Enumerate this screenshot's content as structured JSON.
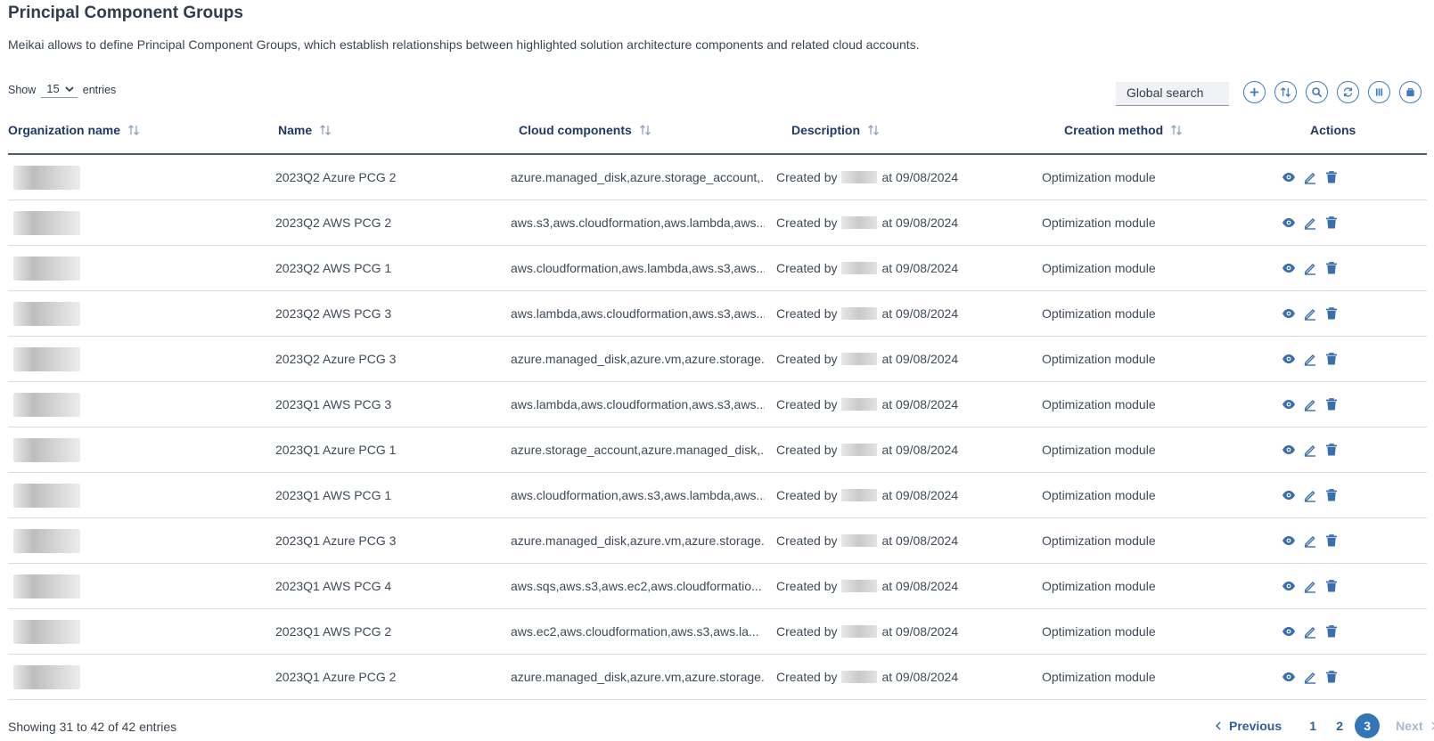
{
  "page": {
    "title": "Principal Component Groups",
    "description": "Meikai allows to define Principal Component Groups, which establish relationships between highlighted solution architecture components and related cloud accounts."
  },
  "length": {
    "show": "Show",
    "value": "15",
    "entries": "entries"
  },
  "search": {
    "placeholder": "Global search"
  },
  "toolbar": [
    "add-icon",
    "sort-icon",
    "search-icon",
    "refresh-icon",
    "columns-icon",
    "export-icon"
  ],
  "columns": {
    "org": "Organization name",
    "name": "Name",
    "cloud": "Cloud components",
    "desc": "Description",
    "method": "Creation method",
    "actions": "Actions"
  },
  "rows": [
    {
      "name": "2023Q2 Azure PCG 2",
      "cloud": "azure.managed_disk,azure.storage_account,...",
      "desc_prefix": "Created by",
      "desc_suffix": "at 09/08/2024",
      "method": "Optimization module"
    },
    {
      "name": "2023Q2 AWS PCG 2",
      "cloud": "aws.s3,aws.cloudformation,aws.lambda,aws...",
      "desc_prefix": "Created by",
      "desc_suffix": "at 09/08/2024",
      "method": "Optimization module"
    },
    {
      "name": "2023Q2 AWS PCG 1",
      "cloud": "aws.cloudformation,aws.lambda,aws.s3,aws...",
      "desc_prefix": "Created by",
      "desc_suffix": "at 09/08/2024",
      "method": "Optimization module"
    },
    {
      "name": "2023Q2 AWS PCG 3",
      "cloud": "aws.lambda,aws.cloudformation,aws.s3,aws...",
      "desc_prefix": "Created by",
      "desc_suffix": "at 09/08/2024",
      "method": "Optimization module"
    },
    {
      "name": "2023Q2 Azure PCG 3",
      "cloud": "azure.managed_disk,azure.vm,azure.storage...",
      "desc_prefix": "Created by",
      "desc_suffix": "at 09/08/2024",
      "method": "Optimization module"
    },
    {
      "name": "2023Q1 AWS PCG 3",
      "cloud": "aws.lambda,aws.cloudformation,aws.s3,aws...",
      "desc_prefix": "Created by",
      "desc_suffix": "at 09/08/2024",
      "method": "Optimization module"
    },
    {
      "name": "2023Q1 Azure PCG 1",
      "cloud": "azure.storage_account,azure.managed_disk,...",
      "desc_prefix": "Created by",
      "desc_suffix": "at 09/08/2024",
      "method": "Optimization module"
    },
    {
      "name": "2023Q1 AWS PCG 1",
      "cloud": "aws.cloudformation,aws.s3,aws.lambda,aws...",
      "desc_prefix": "Created by",
      "desc_suffix": "at 09/08/2024",
      "method": "Optimization module"
    },
    {
      "name": "2023Q1 Azure PCG 3",
      "cloud": "azure.managed_disk,azure.vm,azure.storage...",
      "desc_prefix": "Created by",
      "desc_suffix": "at 09/08/2024",
      "method": "Optimization module"
    },
    {
      "name": "2023Q1 AWS PCG 4",
      "cloud": "aws.sqs,aws.s3,aws.ec2,aws.cloudformatio...",
      "desc_prefix": "Created by",
      "desc_suffix": "at 09/08/2024",
      "method": "Optimization module"
    },
    {
      "name": "2023Q1 AWS PCG 2",
      "cloud": "aws.ec2,aws.cloudformation,aws.s3,aws.la...",
      "desc_prefix": "Created by",
      "desc_suffix": "at 09/08/2024",
      "method": "Optimization module"
    },
    {
      "name": "2023Q1 Azure PCG 2",
      "cloud": "azure.managed_disk,azure.vm,azure.storage...",
      "desc_prefix": "Created by",
      "desc_suffix": "at 09/08/2024",
      "method": "Optimization module"
    }
  ],
  "row_actions": [
    "view-icon",
    "edit-icon",
    "delete-icon"
  ],
  "footer": {
    "info": "Showing 31 to 42 of 42 entries",
    "previous": "Previous",
    "pages": [
      "1",
      "2",
      "3"
    ],
    "current": "3",
    "next": "Next"
  },
  "colors": {
    "accent": "#3475b8",
    "heading": "#1e3a66",
    "text": "#3e4a59",
    "divider": "#d5dbe3"
  }
}
